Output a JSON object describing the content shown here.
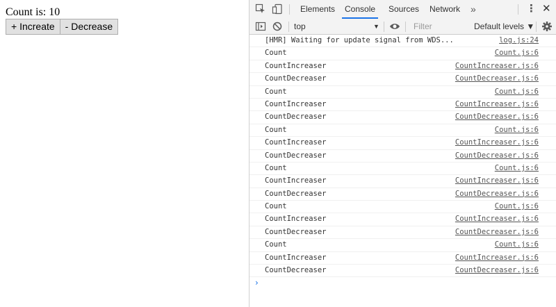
{
  "app": {
    "count_label": "Count is: 10",
    "increment_label": "+ Increate",
    "decrement_label": "- Decrease"
  },
  "devtools": {
    "tabs": [
      "Elements",
      "Console",
      "Sources",
      "Network"
    ],
    "active_tab": "Console",
    "more_label": "»",
    "kebab_label": "⋮",
    "close_label": "✕",
    "context": "top",
    "filter_placeholder": "Filter",
    "levels_label": "Default levels ▼",
    "prompt": "›",
    "logs": [
      {
        "msg": "[HMR] Waiting for update signal from WDS...",
        "src": "log.js:24"
      },
      {
        "msg": "Count",
        "src": "Count.js:6"
      },
      {
        "msg": "CountIncreaser",
        "src": "CountIncreaser.js:6"
      },
      {
        "msg": "CountDecreaser",
        "src": "CountDecreaser.js:6"
      },
      {
        "msg": "Count",
        "src": "Count.js:6"
      },
      {
        "msg": "CountIncreaser",
        "src": "CountIncreaser.js:6"
      },
      {
        "msg": "CountDecreaser",
        "src": "CountDecreaser.js:6"
      },
      {
        "msg": "Count",
        "src": "Count.js:6"
      },
      {
        "msg": "CountIncreaser",
        "src": "CountIncreaser.js:6"
      },
      {
        "msg": "CountDecreaser",
        "src": "CountDecreaser.js:6"
      },
      {
        "msg": "Count",
        "src": "Count.js:6"
      },
      {
        "msg": "CountIncreaser",
        "src": "CountIncreaser.js:6"
      },
      {
        "msg": "CountDecreaser",
        "src": "CountDecreaser.js:6"
      },
      {
        "msg": "Count",
        "src": "Count.js:6"
      },
      {
        "msg": "CountIncreaser",
        "src": "CountIncreaser.js:6"
      },
      {
        "msg": "CountDecreaser",
        "src": "CountDecreaser.js:6"
      },
      {
        "msg": "Count",
        "src": "Count.js:6"
      },
      {
        "msg": "CountIncreaser",
        "src": "CountIncreaser.js:6"
      },
      {
        "msg": "CountDecreaser",
        "src": "CountDecreaser.js:6"
      }
    ]
  }
}
